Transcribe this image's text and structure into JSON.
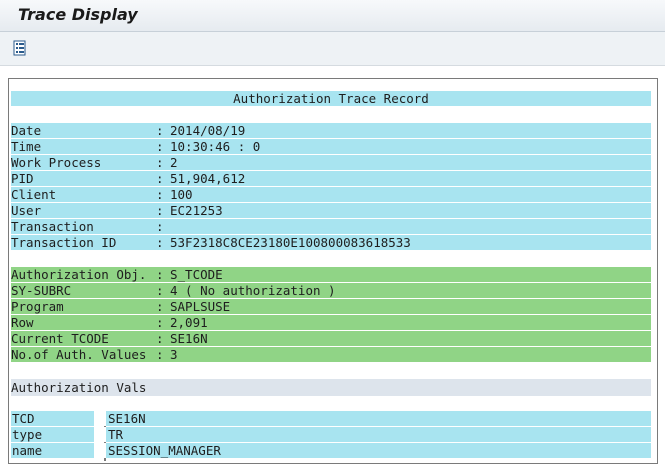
{
  "window": {
    "title": "Trace Display"
  },
  "toolbar": {
    "icon": "list-details-icon"
  },
  "record": {
    "header": "Authorization Trace Record",
    "general": [
      {
        "label": "Date",
        "value": "2014/08/19"
      },
      {
        "label": "Time",
        "value": "10:30:46 : 0"
      },
      {
        "label": "Work Process",
        "value": "2"
      },
      {
        "label": "PID",
        "value": "51,904,612"
      },
      {
        "label": "Client",
        "value": "100"
      },
      {
        "label": "User",
        "value": "EC21253"
      },
      {
        "label": "Transaction",
        "value": ""
      },
      {
        "label": "Transaction ID",
        "value": "53F2318C8CE23180E100800083618533"
      }
    ],
    "auth": [
      {
        "label": "Authorization Obj.",
        "value": "S_TCODE"
      },
      {
        "label": "SY-SUBRC",
        "value": "4 ( No authorization )"
      },
      {
        "label": "Program",
        "value": "SAPLSUSE"
      },
      {
        "label": "Row",
        "value": "2,091"
      },
      {
        "label": "Current TCODE",
        "value": "SE16N"
      },
      {
        "label": "No.of Auth. Values",
        "value": "3"
      }
    ],
    "vals_title": "Authorization Vals",
    "vals": [
      {
        "field": "TCD",
        "value": "SE16N"
      },
      {
        "field": "type",
        "value": "TR"
      },
      {
        "field": "name",
        "value": "SESSION_MANAGER"
      }
    ]
  },
  "colors": {
    "general_bg": "#a8e4f0",
    "auth_bg": "#90d486",
    "section_bg": "#dde4ec"
  }
}
